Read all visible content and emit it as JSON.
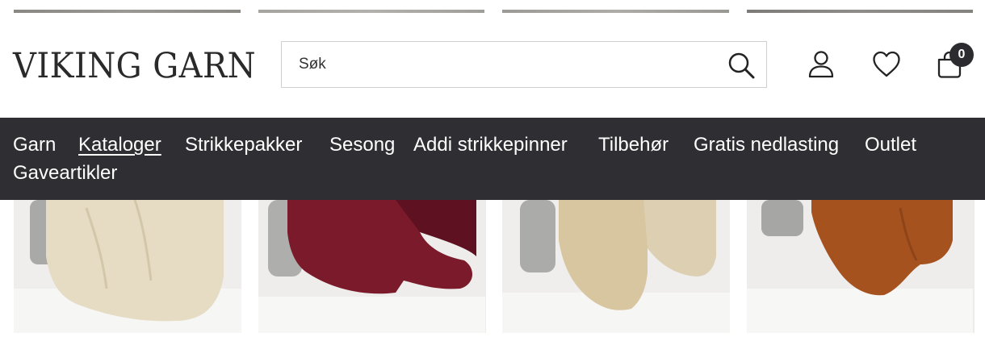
{
  "header": {
    "logo_text": "VIKING GARN",
    "search": {
      "placeholder": "Søk",
      "value": ""
    },
    "cart_count": "0"
  },
  "nav": {
    "items": [
      {
        "label": "Garn",
        "active": false
      },
      {
        "label": "Kataloger",
        "active": true
      },
      {
        "label": "Strikkepakker",
        "active": false
      },
      {
        "label": "Sesong",
        "active": false
      },
      {
        "label": "Addi strikkepinner",
        "active": false
      },
      {
        "label": "Tilbehør",
        "active": false
      },
      {
        "label": "Gratis nedlasting",
        "active": false
      },
      {
        "label": "Outlet",
        "active": false
      },
      {
        "label": "Gaveartikler",
        "active": false
      }
    ]
  },
  "products": [
    {
      "image": "cream-knitted-dishcloth",
      "color": "#e6dcc3"
    },
    {
      "image": "burgundy-knitted-dishcloth",
      "color": "#7a1a2a"
    },
    {
      "image": "beige-knitted-dishcloth",
      "color": "#d8c6a0"
    },
    {
      "image": "rust-knitted-dishcloth",
      "color": "#a5521f"
    }
  ],
  "colors": {
    "nav_background": "#2e2e33",
    "badge": "#2b2b30"
  }
}
